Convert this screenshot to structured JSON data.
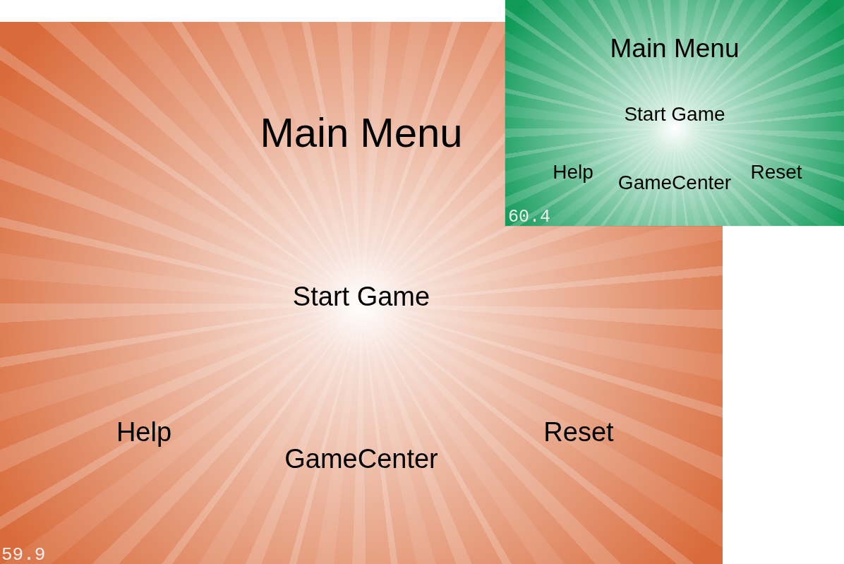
{
  "screens": [
    {
      "color": "#d96b3b",
      "title": "Main Menu",
      "menu_items": [
        "Start Game",
        "Help",
        "GameCenter",
        "Reset"
      ],
      "fps": "59.9"
    },
    {
      "color": "#0f9a58",
      "title": "Main Menu",
      "menu_items": [
        "Start Game",
        "Help",
        "GameCenter",
        "Reset"
      ],
      "fps": "60.4"
    }
  ]
}
